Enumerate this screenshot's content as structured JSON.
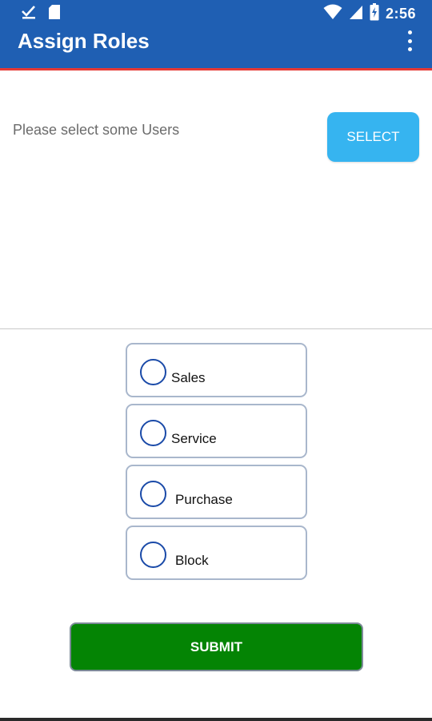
{
  "status_bar": {
    "time": "2:56",
    "icons": [
      "download-done-icon",
      "sd-card-icon",
      "wifi-icon",
      "cell-signal-icon",
      "battery-icon"
    ]
  },
  "app_bar": {
    "title": "Assign Roles",
    "menu_icon": "more-vert-icon",
    "color": "#1f5fb3",
    "accent_line_color": "#e53935"
  },
  "users": {
    "prompt": "Please select some Users",
    "select_label": "SELECT",
    "select_color": "#36b4f0"
  },
  "roles": [
    {
      "label": "Sales",
      "selected": false
    },
    {
      "label": "Service",
      "selected": false
    },
    {
      "label": "Purchase",
      "selected": false
    },
    {
      "label": "Block",
      "selected": false
    }
  ],
  "submit": {
    "label": "SUBMIT",
    "color": "#048404"
  }
}
